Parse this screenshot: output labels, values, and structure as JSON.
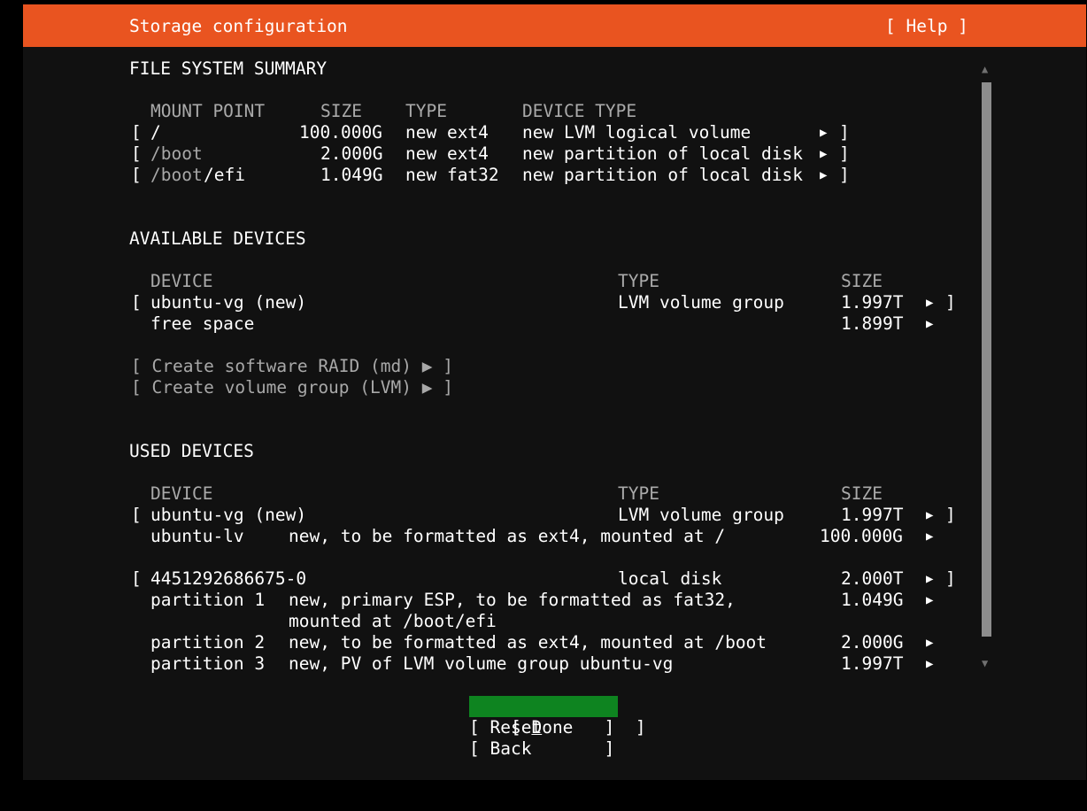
{
  "header": {
    "title": "Storage configuration",
    "help": "[ Help ]"
  },
  "fs_summary": {
    "title": "FILE SYSTEM SUMMARY",
    "columns": [
      "MOUNT POINT",
      "SIZE",
      "TYPE",
      "DEVICE TYPE"
    ],
    "rows": [
      {
        "mount": "/",
        "size": "100.000G",
        "type": "new ext4",
        "device_type": "new LVM logical volume"
      },
      {
        "mount_dim": "/boot",
        "mount_tail": "",
        "size": "2.000G",
        "type": "new ext4",
        "device_type": "new partition of local disk"
      },
      {
        "mount_dim": "/boot",
        "mount_tail": "/efi",
        "size": "1.049G",
        "type": "new fat32",
        "device_type": "new partition of local disk"
      }
    ]
  },
  "available": {
    "title": "AVAILABLE DEVICES",
    "columns": [
      "DEVICE",
      "TYPE",
      "SIZE"
    ],
    "device": {
      "name": "ubuntu-vg (new)",
      "type": "LVM volume group",
      "size": "1.997T"
    },
    "free": {
      "name": "free space",
      "size": "1.899T"
    },
    "actions": [
      "[ Create software RAID (md) ▶ ]",
      "[ Create volume group (LVM) ▶ ]"
    ]
  },
  "used": {
    "title": "USED DEVICES",
    "columns": [
      "DEVICE",
      "TYPE",
      "SIZE"
    ],
    "vg": {
      "name": "ubuntu-vg (new)",
      "type": "LVM volume group",
      "size": "1.997T"
    },
    "lv": {
      "name": "ubuntu-lv",
      "desc": "new, to be formatted as ext4, mounted at /",
      "size": "100.000G"
    },
    "disk": {
      "name": "4451292686675-0",
      "type": "local disk",
      "size": "2.000T"
    },
    "partitions": [
      {
        "name": "partition 1",
        "desc": "new, primary ESP, to be formatted as fat32,",
        "desc2": "mounted at /boot/efi",
        "size": "1.049G"
      },
      {
        "name": "partition 2",
        "desc": "new, to be formatted as ext4, mounted at /boot",
        "size": "2.000G"
      },
      {
        "name": "partition 3",
        "desc": "new, PV of LVM volume group ubuntu-vg",
        "size": "1.997T"
      }
    ]
  },
  "buttons": {
    "done_prefix": "[ ",
    "done_hot": "D",
    "done_rest": "one",
    "done_suffix": "      ]",
    "reset": "[ Reset      ]",
    "back": "[ Back       ]"
  },
  "glyphs": {
    "open": "[",
    "close": "]",
    "arrow": "▶",
    "scroll_up": "▲",
    "scroll_down": "▼"
  },
  "colors": {
    "header": "#e95420",
    "background": "#111111",
    "selected_button": "#0e8420"
  }
}
